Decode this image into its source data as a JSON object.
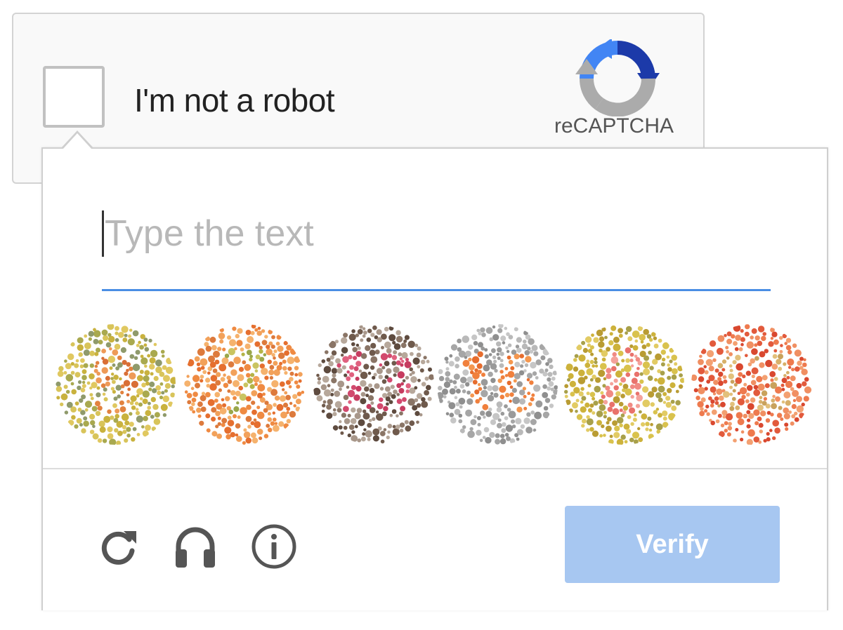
{
  "anchor": {
    "checkbox_label": "I'm not a robot",
    "brand": "reCAPTCHA",
    "logo_icon": "recaptcha-logo-icon"
  },
  "challenge": {
    "input_value": "",
    "input_placeholder": "Type the text",
    "plates": [
      {
        "number": "9",
        "bg_colors": [
          "#c9b23e",
          "#a9a94f",
          "#d8c45a",
          "#8f9a6b",
          "#e0c860"
        ],
        "digit_colors": [
          "#e2823f",
          "#ee9a57",
          "#d96f36"
        ]
      },
      {
        "number": "7",
        "bg_colors": [
          "#ef8a42",
          "#f2a15a",
          "#e56f2f",
          "#f5b26d",
          "#dd7a3c"
        ],
        "digit_colors": [
          "#b4b447",
          "#c9c461",
          "#9aa74a"
        ]
      },
      {
        "number": "13",
        "bg_colors": [
          "#6f5a4c",
          "#8a7566",
          "#a8978a",
          "#5e4b3f",
          "#b7a89b"
        ],
        "digit_colors": [
          "#d24a6e",
          "#e0617f",
          "#c63c60"
        ]
      },
      {
        "number": "16",
        "bg_colors": [
          "#a6a6a6",
          "#b9b9b9",
          "#9a9a9a",
          "#c6c6c6",
          "#8f8f8f"
        ],
        "digit_colors": [
          "#f0803d",
          "#e66d2e",
          "#f4974f"
        ]
      },
      {
        "number": "8",
        "bg_colors": [
          "#cdb23b",
          "#d9c24d",
          "#b99c33",
          "#e2cb64",
          "#a8a04a"
        ],
        "digit_colors": [
          "#f08a83",
          "#e9726c",
          "#f4a29a"
        ]
      },
      {
        "number": "12",
        "bg_colors": [
          "#e25a3c",
          "#ee7a4e",
          "#f08f62",
          "#d9482f",
          "#f3a071"
        ],
        "digit_colors": [
          "#d7b06a",
          "#c9a25c",
          "#e2c07b"
        ]
      }
    ]
  },
  "footer": {
    "reload_icon": "reload-icon",
    "audio_icon": "headphones-icon",
    "info_icon": "info-icon",
    "verify_label": "Verify"
  },
  "colors": {
    "accent": "#4a8ee4",
    "verify_bg": "#a7c7f1",
    "icon": "#555555"
  }
}
